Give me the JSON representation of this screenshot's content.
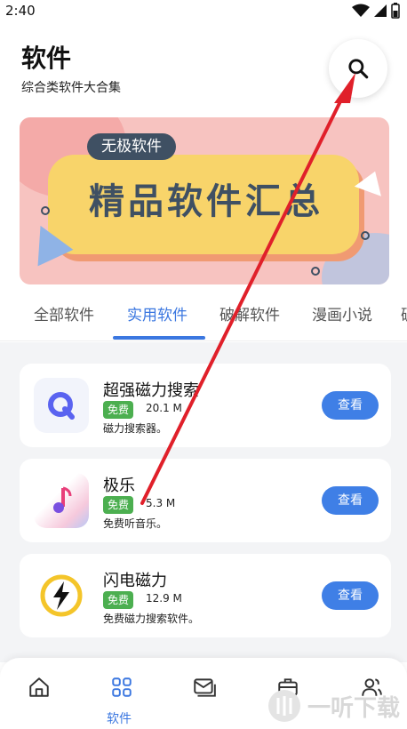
{
  "status": {
    "time": "2:40"
  },
  "header": {
    "title": "软件",
    "subtitle": "综合类软件大合集"
  },
  "banner": {
    "tag": "无极软件",
    "headline": "精品软件汇总"
  },
  "tabs": [
    {
      "label": "全部软件"
    },
    {
      "label": "实用软件",
      "active": true
    },
    {
      "label": "破解软件"
    },
    {
      "label": "漫画小说"
    },
    {
      "label": "破"
    }
  ],
  "apps": [
    {
      "name": "超强磁力搜索",
      "badge": "免费",
      "size": "20.1 M",
      "desc": "磁力搜索器。",
      "button": "查看",
      "icon": "q-magnet-icon"
    },
    {
      "name": "极乐",
      "badge": "免费",
      "size": "5.3 M",
      "desc": "免费听音乐。",
      "button": "查看",
      "icon": "music-note-icon"
    },
    {
      "name": "闪电磁力",
      "badge": "免费",
      "size": "12.9 M",
      "desc": "免费磁力搜索软件。",
      "button": "查看",
      "icon": "lightning-icon"
    }
  ],
  "bottom_nav": {
    "active_label": "软件"
  },
  "watermark": {
    "text": "一听下载"
  },
  "colors": {
    "accent": "#3b77e0",
    "badge": "#4caf50",
    "arrow": "#e0202a"
  }
}
